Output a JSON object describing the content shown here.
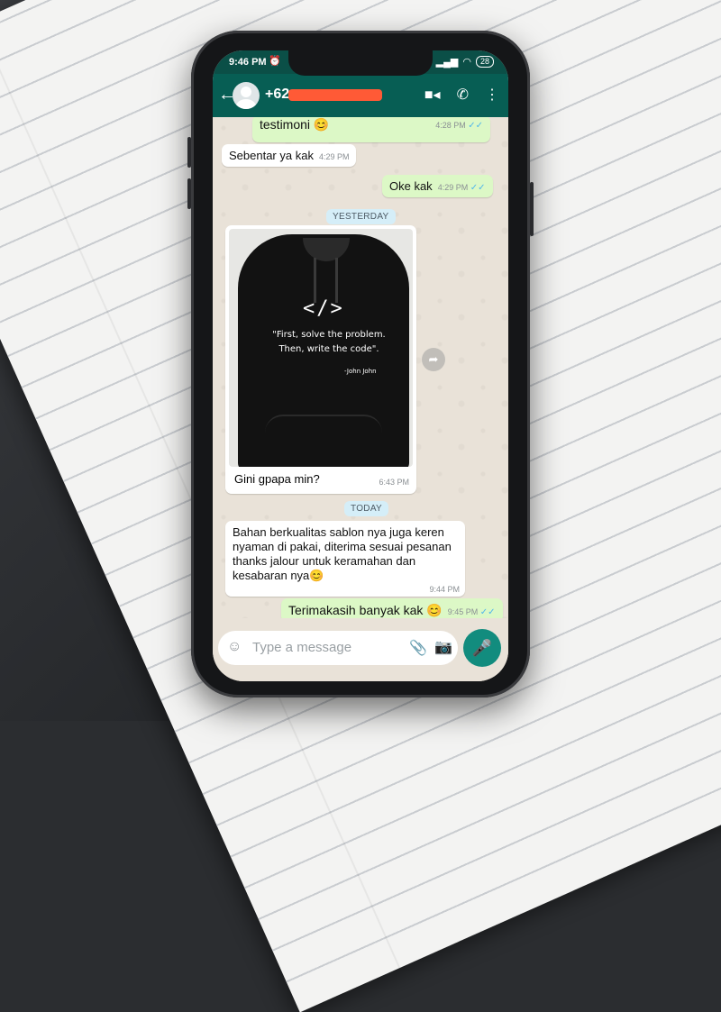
{
  "status": {
    "time": "9:46 PM",
    "alarm_icon": "alarm-icon",
    "battery": "28"
  },
  "header": {
    "contact": "+62",
    "back_icon": "arrow-left-icon",
    "icons": [
      "video-call-icon",
      "phone-icon",
      "more-vert-icon"
    ]
  },
  "messages": [
    {
      "dir": "out",
      "text": "testimoni 😊",
      "time": "4:28 PM",
      "ticks": "✓✓"
    },
    {
      "dir": "in",
      "text": "Sebentar ya kak",
      "time": "4:29 PM"
    },
    {
      "dir": "out",
      "text": "Oke kak",
      "time": "4:29 PM",
      "ticks": "✓✓"
    }
  ],
  "day_yesterday": "YESTERDAY",
  "image_message": {
    "caption": "Gini gpapa min?",
    "time": "6:43 PM",
    "shirt_code": "</>",
    "shirt_quote": "\"First, solve the problem. Then, write the code\".",
    "shirt_author": "-John John"
  },
  "day_today": "TODAY",
  "today_messages": [
    {
      "dir": "in",
      "text": "Bahan berkualitas sablon nya juga keren nyaman di pakai, diterima sesuai pesanan thanks jalour untuk keramahan dan kesabaran nya😊",
      "time": "9:44 PM"
    },
    {
      "dir": "out",
      "text": "Terimakasih banyak kak 😊",
      "time": "9:45 PM",
      "ticks": "✓✓"
    }
  ],
  "composer": {
    "placeholder": "Type a message"
  },
  "colors": {
    "header": "#075e54",
    "outgoing": "#dcf8c6",
    "incoming": "#ffffff",
    "mic": "#128c7e"
  }
}
